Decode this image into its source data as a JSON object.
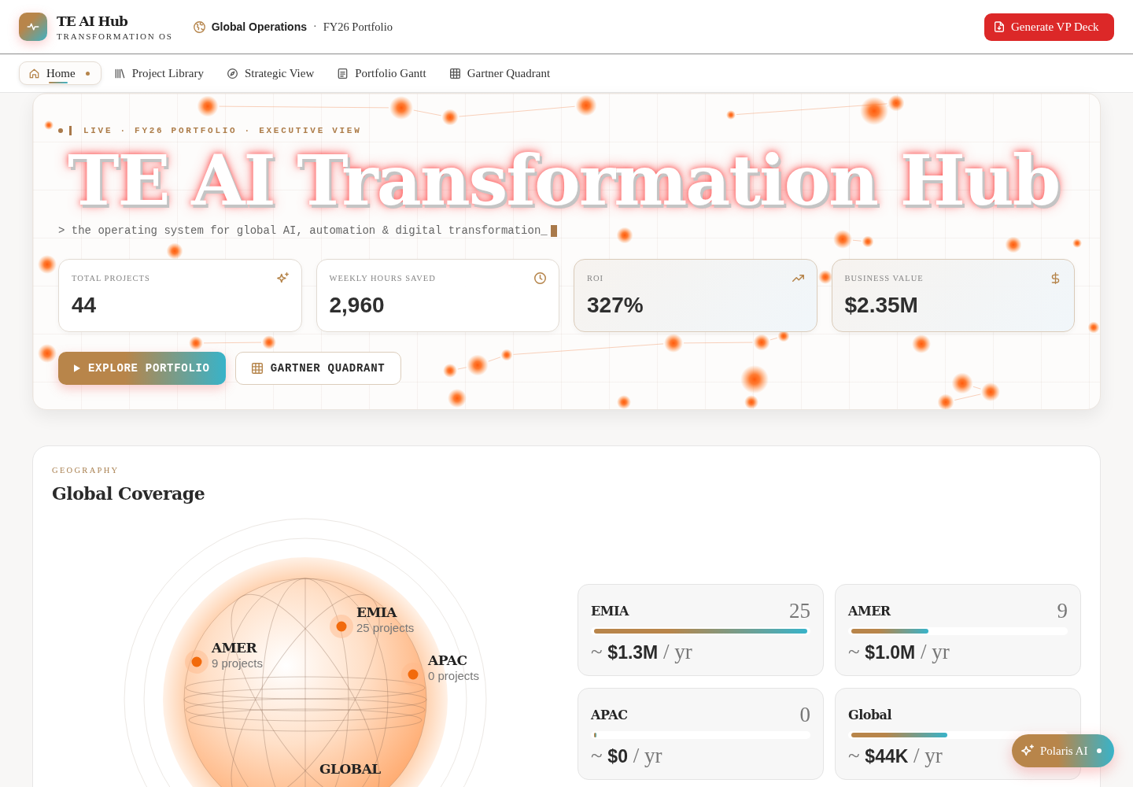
{
  "header": {
    "brand": "TE AI Hub",
    "tagline": "TRANSFORMATION OS",
    "workspace": "Global Operations",
    "separator": "·",
    "portfolio": "FY26 Portfolio",
    "action": "Generate VP Deck"
  },
  "nav": [
    {
      "label": "Home",
      "selected": true
    },
    {
      "label": "Project Library",
      "selected": false
    },
    {
      "label": "Strategic View",
      "selected": false
    },
    {
      "label": "Portfolio Gantt",
      "selected": false
    },
    {
      "label": "Gartner Quadrant",
      "selected": false
    }
  ],
  "hero": {
    "eyebrow": "LIVE · FY26 PORTFOLIO · EXECUTIVE VIEW",
    "title": "TE AI Transformation Hub",
    "tagline": "> the operating system for global AI, automation & digital transformation_",
    "stats": [
      {
        "label": "TOTAL PROJECTS",
        "value": "44"
      },
      {
        "label": "WEEKLY HOURS SAVED",
        "value": "2,960"
      },
      {
        "label": "ROI",
        "value": "327%"
      },
      {
        "label": "BUSINESS VALUE",
        "value": "$2.35M"
      }
    ],
    "buttons": [
      {
        "kind": "primary",
        "label": "EXPLORE PORTFOLIO"
      },
      {
        "kind": "secondary",
        "label": "GARTNER QUADRANT"
      }
    ]
  },
  "geography": {
    "eyebrow": "GEOGRAPHY",
    "title": "Global Coverage",
    "markers": [
      {
        "name": "AMER",
        "detail": "9 projects"
      },
      {
        "name": "EMIA",
        "detail": "25 projects"
      },
      {
        "name": "APAC",
        "detail": "0 projects"
      }
    ],
    "footer_label": "GLOBAL",
    "regions": [
      {
        "name": "EMIA",
        "count": "25",
        "level": 1,
        "value": "~ **$1.3M** / yr"
      },
      {
        "name": "AMER",
        "count": "9",
        "level": 0.36,
        "value": "~ **$1.0M** / yr"
      },
      {
        "name": "APAC",
        "count": "0",
        "level": 0,
        "value": "~ **$0** / yr"
      },
      {
        "name": "Global",
        "level": 0.45,
        "value": "~ **$44K** / yr"
      }
    ]
  },
  "assistant": {
    "label": "Polaris AI"
  }
}
